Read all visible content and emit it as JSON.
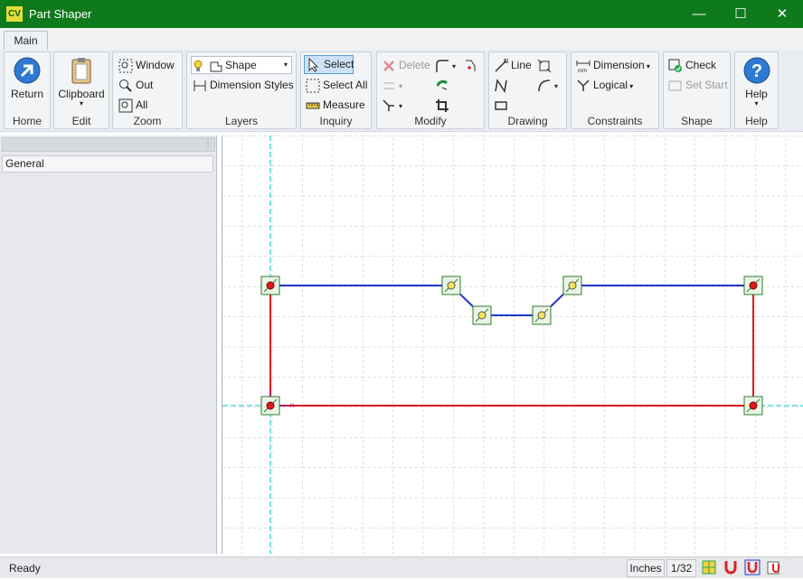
{
  "window": {
    "title": "Part Shaper",
    "icon_text": "CV"
  },
  "ribbon_tabs": [
    "Main"
  ],
  "groups": {
    "home": {
      "label": "Home",
      "return": "Return"
    },
    "edit": {
      "label": "Edit",
      "clipboard": "Clipboard"
    },
    "zoom": {
      "label": "Zoom",
      "window": "Window",
      "out": "Out",
      "all": "All"
    },
    "layers": {
      "label": "Layers",
      "shape": "Shape",
      "dimension_styles": "Dimension Styles"
    },
    "inquiry": {
      "label": "Inquiry",
      "select": "Select",
      "select_all": "Select All",
      "measure": "Measure"
    },
    "modify": {
      "label": "Modify",
      "delete": "Delete"
    },
    "drawing": {
      "label": "Drawing",
      "line": "Line"
    },
    "constraints": {
      "label": "Constraints",
      "dimension": "Dimension",
      "logical": "Logical"
    },
    "shape": {
      "label": "Shape",
      "check": "Check",
      "set_start": "Set Start"
    },
    "help": {
      "label": "Help",
      "help": "Help"
    }
  },
  "left_panel": {
    "item": "General"
  },
  "status": {
    "text": "Ready",
    "units": "Inches",
    "precision": "1/32"
  },
  "colors": {
    "titlebar": "#0f7a1c",
    "outline_blue": "#1f36c8",
    "outline_red": "#e11b1b",
    "axis": "#00c4c4"
  }
}
